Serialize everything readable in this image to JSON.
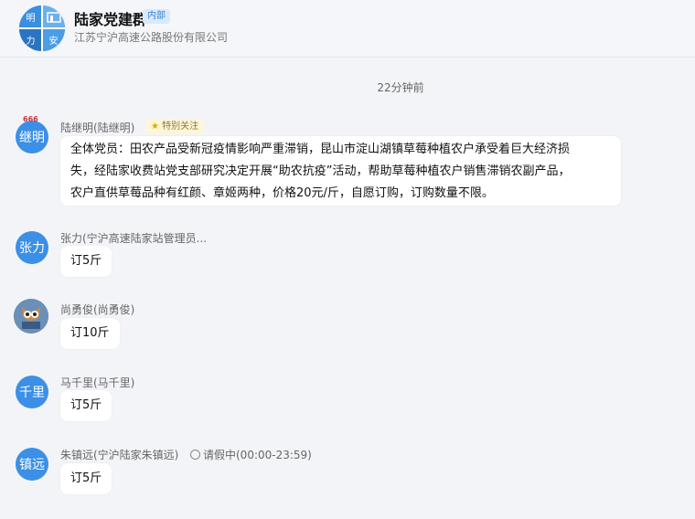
{
  "header": {
    "avatar_chars": [
      "明",
      "",
      "力",
      "安"
    ],
    "group_name": "陆家党建群",
    "group_tag": "内部",
    "company": "江苏宁沪高速公路股份有限公司"
  },
  "timestamp": "22分钟前",
  "messages": [
    {
      "avatar_text": "继明",
      "avatar_badge": "666",
      "sender": "陆继明(陆继明)",
      "tag": "特别关注",
      "text_lines": [
        "全体党员：田农产品受新冠疫情影响严重滞销，昆山市淀山湖镇草莓种植农户承受着巨大经济损",
        "失，经陆家收费站党支部研究决定开展“助农抗疫”活动，帮助草莓种植农户销售滞销农副产品，",
        "农户直供草莓品种有红颜、章姬两种，价格20元/斤，自愿订购，订购数量不限。"
      ]
    },
    {
      "avatar_text": "张力",
      "sender": "张力(宁沪高速陆家站管理员...",
      "text": "订5斤"
    },
    {
      "avatar_text": "",
      "sender": "尚勇俊(尚勇俊)",
      "text": "订10斤"
    },
    {
      "avatar_text": "千里",
      "sender": "马千里(马千里)",
      "text": "订5斤"
    },
    {
      "avatar_text": "镇远",
      "sender": "朱镇远(宁沪陆家朱镇远)",
      "status": "请假中(00:00-23:59)",
      "text": "订5斤"
    }
  ]
}
